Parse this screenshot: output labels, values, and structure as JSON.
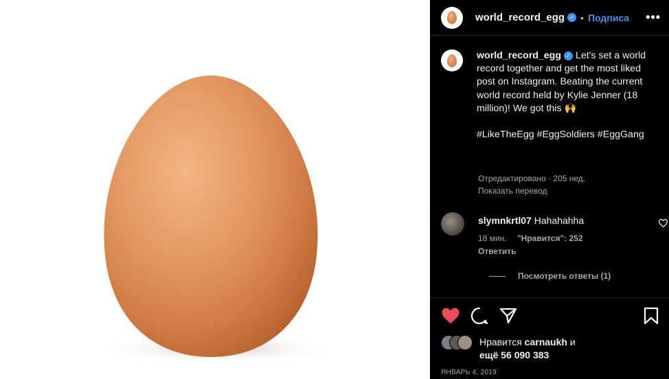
{
  "header": {
    "username": "world_record_egg",
    "verified_glyph": "✓",
    "separator": "•",
    "follow_label": "Подписа",
    "more_label": "•••"
  },
  "caption": {
    "username": "world_record_egg",
    "text": "Let's set a world record together and get the most liked post on Instagram. Beating the current world record held by Kylie Jenner (18 million)! We got this 🙌",
    "hashtags": "#LikeTheEgg #EggSoldiers #EggGang",
    "edited": "Отредактировано · 205 нед.",
    "translate": "Показать перевод"
  },
  "comment": {
    "username": "slymnkrtl07",
    "text": "Hahahahha",
    "time": "18 мин.",
    "likes": "\"Нравится\": 252",
    "reply": "Ответить",
    "view_replies": "Посмотреть ответы (1)"
  },
  "likes": {
    "prefix": "Нравится",
    "user": "carnaukh",
    "and": "и",
    "count_text": "ещё 56 090 383"
  },
  "date": "ЯНВАРЬ 4, 2019",
  "colors": {
    "accent": "#3897f0",
    "like_red": "#ed4956",
    "background": "#000000"
  },
  "icons": [
    "heart-icon",
    "comment-icon",
    "share-icon",
    "bookmark-icon",
    "verified-badge-icon",
    "more-icon"
  ]
}
